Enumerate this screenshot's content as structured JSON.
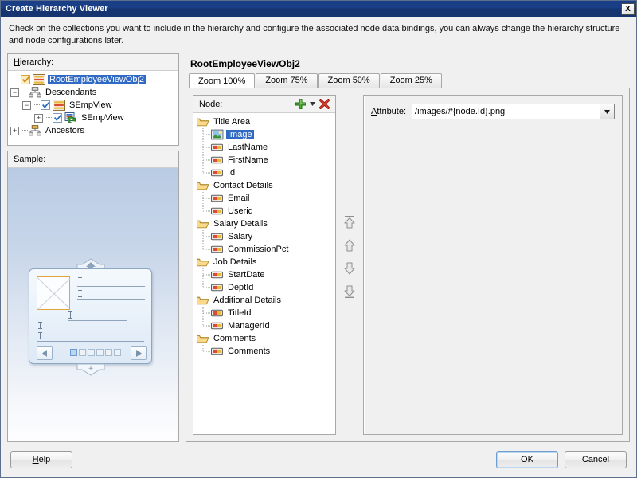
{
  "window": {
    "title": "Create Hierarchy Viewer",
    "close_label": "X",
    "close_icon": "close-icon"
  },
  "instruction": "Check on the collections you want to include in the hierarchy and configure the associated node data bindings, you can always change the hierarchy structure and node configurations later.",
  "hierarchy": {
    "label": "Hierarchy:",
    "nodes": [
      {
        "label": "RootEmployeeViewObj2",
        "icon": "view-object-icon",
        "checkbox": "checked-orange",
        "selected": true,
        "indent": 0,
        "expander": "none"
      },
      {
        "label": "Descendants",
        "icon": "descendants-icon",
        "checkbox": "none",
        "selected": false,
        "indent": 0,
        "expander": "minus"
      },
      {
        "label": "SEmpView",
        "icon": "view-object-icon",
        "checkbox": "checked",
        "selected": false,
        "indent": 1,
        "expander": "minus"
      },
      {
        "label": "SEmpView",
        "icon": "accessor-icon",
        "checkbox": "checked",
        "selected": false,
        "indent": 2,
        "expander": "plus"
      },
      {
        "label": "Ancestors",
        "icon": "ancestors-icon",
        "checkbox": "none",
        "selected": false,
        "indent": 0,
        "expander": "plus"
      }
    ]
  },
  "sample": {
    "label": "Sample:",
    "prev_icon": "left-arrow-icon",
    "next_icon": "right-arrow-icon",
    "image_placeholder_icon": "image-placeholder-icon",
    "expand_up_icon": "expand-up-icon",
    "expand_down_icon": "expand-down-icon",
    "page_dots": 6,
    "active_dot": 1
  },
  "main": {
    "title": "RootEmployeeViewObj2",
    "tabs": [
      {
        "label": "Zoom 100%",
        "active": true
      },
      {
        "label": "Zoom 75%",
        "active": false
      },
      {
        "label": "Zoom 50%",
        "active": false
      },
      {
        "label": "Zoom 25%",
        "active": false
      }
    ]
  },
  "node_panel": {
    "label": "Node:",
    "add_icon": "green-plus-icon",
    "add_dropdown_icon": "chevron-down-icon",
    "delete_icon": "red-x-delete-icon",
    "items": [
      {
        "label": "Title Area",
        "type": "folder",
        "selected": false,
        "last": false
      },
      {
        "label": "Image",
        "type": "image",
        "selected": true,
        "last": false
      },
      {
        "label": "LastName",
        "type": "attribute",
        "selected": false,
        "last": false
      },
      {
        "label": "FirstName",
        "type": "attribute",
        "selected": false,
        "last": false
      },
      {
        "label": "Id",
        "type": "attribute",
        "selected": false,
        "last": true
      },
      {
        "label": "Contact Details",
        "type": "folder",
        "selected": false,
        "last": false
      },
      {
        "label": "Email",
        "type": "attribute",
        "selected": false,
        "last": false
      },
      {
        "label": "Userid",
        "type": "attribute",
        "selected": false,
        "last": true
      },
      {
        "label": "Salary Details",
        "type": "folder",
        "selected": false,
        "last": false
      },
      {
        "label": "Salary",
        "type": "attribute",
        "selected": false,
        "last": false
      },
      {
        "label": "CommissionPct",
        "type": "attribute",
        "selected": false,
        "last": true
      },
      {
        "label": "Job Details",
        "type": "folder",
        "selected": false,
        "last": false
      },
      {
        "label": "StartDate",
        "type": "attribute",
        "selected": false,
        "last": false
      },
      {
        "label": "DeptId",
        "type": "attribute",
        "selected": false,
        "last": true
      },
      {
        "label": "Additional Details",
        "type": "folder",
        "selected": false,
        "last": false
      },
      {
        "label": "TitleId",
        "type": "attribute",
        "selected": false,
        "last": false
      },
      {
        "label": "ManagerId",
        "type": "attribute",
        "selected": false,
        "last": true
      },
      {
        "label": "Comments",
        "type": "folder",
        "selected": false,
        "last": false
      },
      {
        "label": "Comments",
        "type": "attribute",
        "selected": false,
        "last": true
      }
    ]
  },
  "reorder_buttons": [
    {
      "name": "move-to-top-button",
      "icon": "double-up-arrow-icon"
    },
    {
      "name": "move-up-button",
      "icon": "up-arrow-icon"
    },
    {
      "name": "move-down-button",
      "icon": "down-arrow-icon"
    },
    {
      "name": "move-to-bottom-button",
      "icon": "double-down-arrow-icon"
    }
  ],
  "attribute": {
    "label": "Attribute:",
    "value": "/images/#{node.Id}.png",
    "placeholder": "",
    "dropdown_icon": "chevron-down-icon"
  },
  "footer": {
    "help": "Help",
    "ok": "OK",
    "cancel": "Cancel"
  },
  "colors": {
    "titlebar": "#1b3f86",
    "selection": "#316ac5",
    "accent_orange": "#e3a33c",
    "add_green": "#4caf2e",
    "delete_red": "#d8392b",
    "dialog_bg": "#f0f0f0"
  }
}
